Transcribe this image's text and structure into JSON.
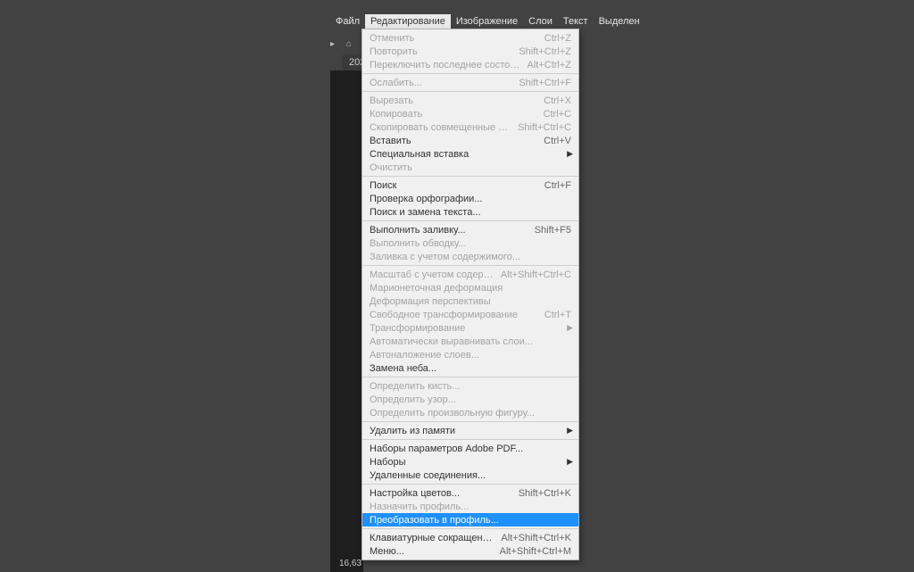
{
  "menubar": {
    "items": [
      {
        "label": "Файл"
      },
      {
        "label": "Редактирование",
        "active": true
      },
      {
        "label": "Изображение"
      },
      {
        "label": "Слои"
      },
      {
        "label": "Текст"
      },
      {
        "label": "Выделен"
      }
    ]
  },
  "tab": {
    "label": "202"
  },
  "status": {
    "text": "16,63"
  },
  "dropdown": {
    "groups": [
      [
        {
          "label": "Отменить",
          "shortcut": "Ctrl+Z",
          "disabled": true
        },
        {
          "label": "Повторить",
          "shortcut": "Shift+Ctrl+Z",
          "disabled": true
        },
        {
          "label": "Переключить последнее состояние",
          "shortcut": "Alt+Ctrl+Z",
          "disabled": true
        }
      ],
      [
        {
          "label": "Ослабить...",
          "shortcut": "Shift+Ctrl+F",
          "disabled": true
        }
      ],
      [
        {
          "label": "Вырезать",
          "shortcut": "Ctrl+X",
          "disabled": true
        },
        {
          "label": "Копировать",
          "shortcut": "Ctrl+C",
          "disabled": true
        },
        {
          "label": "Скопировать совмещенные данные",
          "shortcut": "Shift+Ctrl+C",
          "disabled": true
        },
        {
          "label": "Вставить",
          "shortcut": "Ctrl+V"
        },
        {
          "label": "Специальная вставка",
          "submenu": true
        },
        {
          "label": "Очистить",
          "disabled": true
        }
      ],
      [
        {
          "label": "Поиск",
          "shortcut": "Ctrl+F"
        },
        {
          "label": "Проверка орфографии..."
        },
        {
          "label": "Поиск и замена текста..."
        }
      ],
      [
        {
          "label": "Выполнить заливку...",
          "shortcut": "Shift+F5"
        },
        {
          "label": "Выполнить обводку...",
          "disabled": true
        },
        {
          "label": "Заливка с учетом содержимого...",
          "disabled": true
        }
      ],
      [
        {
          "label": "Масштаб с учетом содержимого",
          "shortcut": "Alt+Shift+Ctrl+C",
          "disabled": true
        },
        {
          "label": "Марионеточная деформация",
          "disabled": true
        },
        {
          "label": "Деформация перспективы",
          "disabled": true
        },
        {
          "label": "Свободное трансформирование",
          "shortcut": "Ctrl+T",
          "disabled": true
        },
        {
          "label": "Трансформирование",
          "submenu": true,
          "disabled": true
        },
        {
          "label": "Автоматически выравнивать слои...",
          "disabled": true
        },
        {
          "label": "Автоналожение слоев...",
          "disabled": true
        },
        {
          "label": "Замена неба..."
        }
      ],
      [
        {
          "label": "Определить кисть...",
          "disabled": true
        },
        {
          "label": "Определить узор...",
          "disabled": true
        },
        {
          "label": "Определить произвольную фигуру...",
          "disabled": true
        }
      ],
      [
        {
          "label": "Удалить из памяти",
          "submenu": true
        }
      ],
      [
        {
          "label": "Наборы параметров Adobe PDF..."
        },
        {
          "label": "Наборы",
          "submenu": true
        },
        {
          "label": "Удаленные соединения..."
        }
      ],
      [
        {
          "label": "Настройка цветов...",
          "shortcut": "Shift+Ctrl+K"
        },
        {
          "label": "Назначить профиль...",
          "disabled": true
        },
        {
          "label": "Преобразовать в профиль...",
          "highlight": true
        }
      ],
      [
        {
          "label": "Клавиатурные сокращения...",
          "shortcut": "Alt+Shift+Ctrl+K"
        },
        {
          "label": "Меню...",
          "shortcut": "Alt+Shift+Ctrl+M"
        }
      ]
    ]
  }
}
